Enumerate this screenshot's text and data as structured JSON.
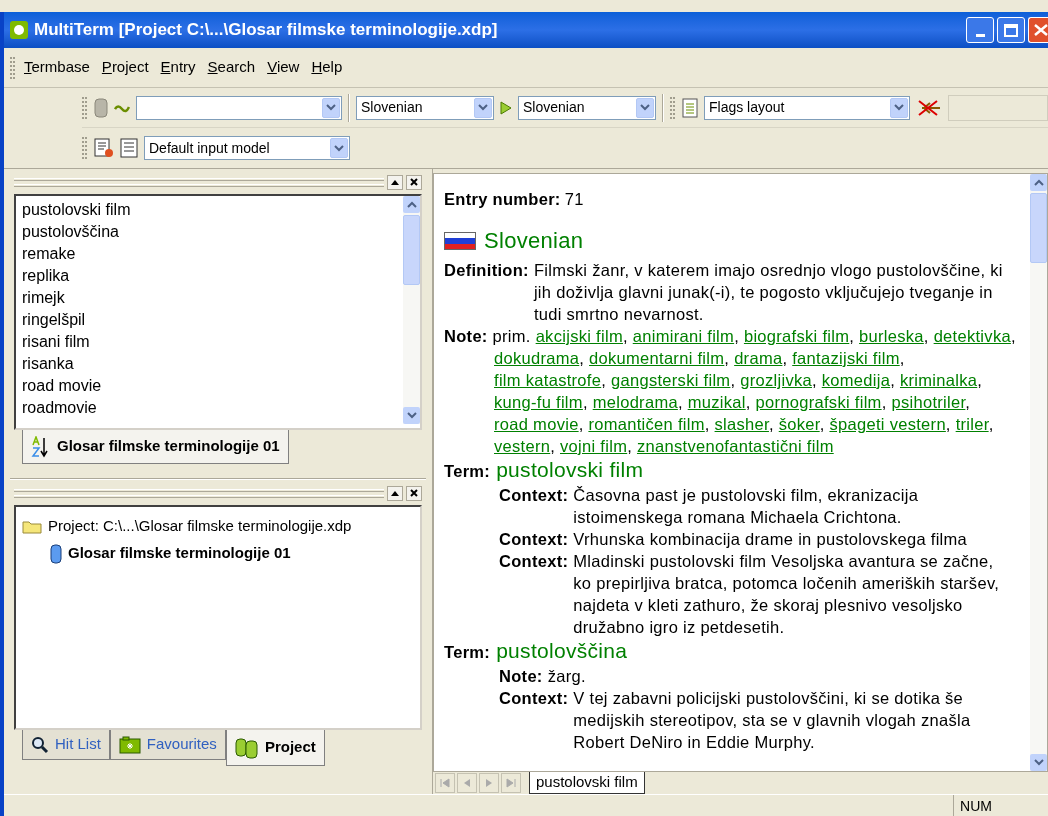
{
  "window": {
    "title": "MultiTerm [Project C:\\...\\Glosar filmske terminologije.xdp]"
  },
  "menu": [
    "Termbase",
    "Project",
    "Entry",
    "Search",
    "View",
    "Help"
  ],
  "toolbar": {
    "source_language": "Slovenian",
    "target_language": "Slovenian",
    "layout": "Flags layout",
    "input_model": "Default input model"
  },
  "term_list": {
    "items": [
      "pustolovski film",
      "pustolovščina",
      "remake",
      "replika",
      "rimejk",
      "ringelšpil",
      "risani film",
      "risanka",
      "road movie",
      "roadmovie"
    ],
    "tabs": [
      {
        "label": "Glosar filmske terminologije 01",
        "selected": true
      }
    ]
  },
  "project_tree": {
    "items": [
      {
        "label": "Project: C:\\...\\Glosar filmske terminologije.xdp",
        "kind": "project",
        "children": [
          {
            "label": "Glosar filmske terminologije 01",
            "kind": "termbase"
          }
        ]
      }
    ]
  },
  "left_tabs": [
    {
      "label": "Hit List",
      "kind": "search",
      "selected": false
    },
    {
      "label": "Favourites",
      "kind": "favourites",
      "selected": false
    },
    {
      "label": "Project",
      "kind": "project",
      "selected": true
    }
  ],
  "entry": {
    "number_label": "Entry number:",
    "number": "71",
    "language": "Slovenian",
    "fields": [
      {
        "kind": "text",
        "label": "Definition:",
        "text": "Filmski žanr, v katerem imajo osrednjo vlogo pustolovščine, ki jih doživlja glavni junak(-i), te pogosto vključujejo tveganje in tudi smrtno nevarnost."
      },
      {
        "kind": "links",
        "label": "Note:",
        "prefix": "prim.",
        "separator": ",",
        "links": [
          "akcijski film",
          "animirani film",
          "biografski film",
          "burleska",
          "detektivka",
          "dokudrama",
          "dokumentarni film",
          "drama",
          "fantazijski film",
          "film katastrofe",
          "gangsterski film",
          "grozljivka",
          "komedija",
          "kriminalka",
          "kung-fu film",
          "melodrama",
          "muzikal",
          "pornografski film",
          "psihotriler",
          "road movie",
          "romantičen film",
          "slasher",
          "šoker",
          "špageti vestern",
          "triler",
          "vestern",
          "vojni film",
          "znanstvenofantastični film"
        ]
      }
    ],
    "terms": [
      {
        "label": "Term:",
        "term": "pustolovski film",
        "fields": [
          {
            "label": "Context:",
            "text": "Časovna past je pustolovski film, ekranizacija istoimenskega romana Michaela Crichtona."
          },
          {
            "label": "Context:",
            "text": "Vrhunska kombinacija drame in pustolovskega filma"
          },
          {
            "label": "Context:",
            "text": "Mladinski pustolovski film Vesoljska avantura se začne, ko prepirljiva bratca, potomca ločenih ameriških staršev, najdeta v kleti zathuro, že skoraj plesnivo vesoljsko družabno igro iz petdesetih."
          }
        ]
      },
      {
        "label": "Term:",
        "term": "pustolovščina",
        "fields": [
          {
            "label": "Note:",
            "text": "žarg."
          },
          {
            "label": "Context:",
            "text": "V tej zabavni policijski pustolovščini, ki se dotika še medijskih stereotipov, sta se v glavnih vlogah znašla Robert DeNiro in Eddie Murphy."
          }
        ]
      }
    ]
  },
  "entry_tabs": [
    {
      "label": "pustolovski film",
      "selected": true
    }
  ],
  "status_bar": {
    "num": "NUM"
  }
}
